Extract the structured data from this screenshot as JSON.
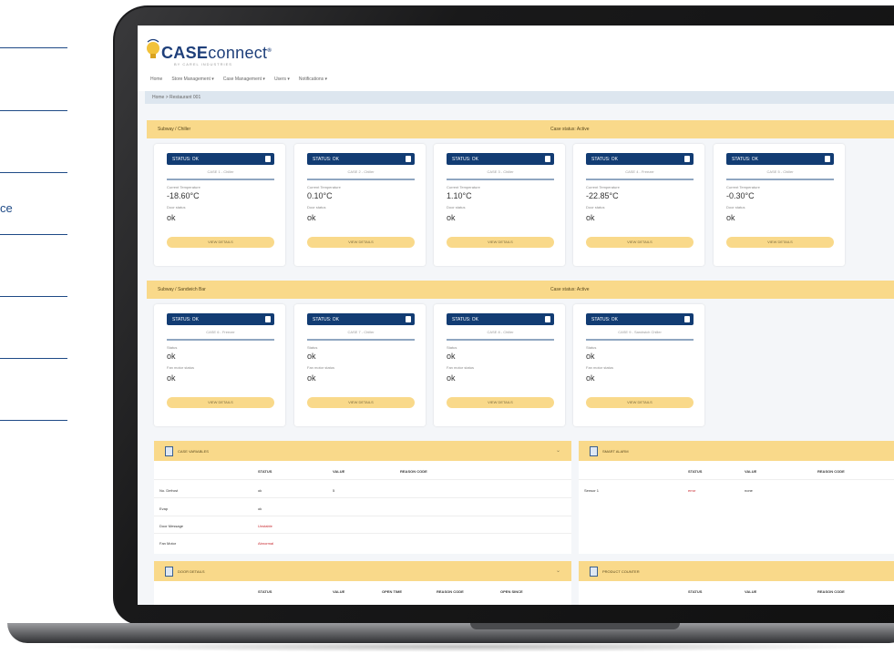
{
  "side_text": "ce",
  "app": {
    "logo_case": "CASE",
    "logo_connect": "connect",
    "logo_tm": "®",
    "tagline": "BY CAREL INDUSTRIES"
  },
  "nav": [
    "Home",
    "Store Management ▾",
    "Case Management ▾",
    "Users ▾",
    "Notifications ▾"
  ],
  "breadcrumb": "Home > Restaurant 001",
  "sections": [
    {
      "title": "Subway / Chiller",
      "middle": "Case status: Active",
      "cards": [
        {
          "status": "STATUS: OK",
          "sub": "CASE 1 - Chiller",
          "k1": "Current Temperature",
          "v1": "-18.60°C",
          "k2": "Door status",
          "v2": "ok",
          "btn": "VIEW DETAILS"
        },
        {
          "status": "STATUS: OK",
          "sub": "CASE 2 - Chiller",
          "k1": "Current Temperature",
          "v1": "0.10°C",
          "k2": "Door status",
          "v2": "ok",
          "btn": "VIEW DETAILS"
        },
        {
          "status": "STATUS: OK",
          "sub": "CASE 3 - Chiller",
          "k1": "Current Temperature",
          "v1": "1.10°C",
          "k2": "Door status",
          "v2": "ok",
          "btn": "VIEW DETAILS"
        },
        {
          "status": "STATUS: OK",
          "sub": "CASE 4 - Freezer",
          "k1": "Current Temperature",
          "v1": "-22.85°C",
          "k2": "Door status",
          "v2": "ok",
          "btn": "VIEW DETAILS"
        },
        {
          "status": "STATUS: OK",
          "sub": "CASE 5 - Chiller",
          "k1": "Current Temperature",
          "v1": "-0.30°C",
          "k2": "Door status",
          "v2": "ok",
          "btn": "VIEW DETAILS"
        }
      ]
    },
    {
      "title": "Subway / Sandwich Bar",
      "middle": "Case status: Active",
      "cards": [
        {
          "status": "STATUS: OK",
          "sub": "CASE 6 - Freezer",
          "k1": "Status",
          "v1": "ok",
          "k2": "Fan motor status",
          "v2": "ok",
          "btn": "VIEW DETAILS"
        },
        {
          "status": "STATUS: OK",
          "sub": "CASE 7 - Chiller",
          "k1": "Status",
          "v1": "ok",
          "k2": "Fan motor status",
          "v2": "ok",
          "btn": "VIEW DETAILS"
        },
        {
          "status": "STATUS: OK",
          "sub": "CASE 8 - Chiller",
          "k1": "Status",
          "v1": "ok",
          "k2": "Fan motor status",
          "v2": "ok",
          "btn": "VIEW DETAILS"
        },
        {
          "status": "STATUS: OK",
          "sub": "CASE 9 - Sandwich Chiller",
          "k1": "Status",
          "v1": "ok",
          "k2": "Fan motor status",
          "v2": "ok",
          "btn": "VIEW DETAILS"
        }
      ]
    }
  ],
  "panels": {
    "case_variables": {
      "title": "CASE VARIABLES",
      "headers": [
        "STATUS",
        "VALUE",
        "REASON CODE"
      ],
      "rows": [
        {
          "name": "No. Defrost",
          "status": "ok",
          "value": "5"
        },
        {
          "name": "Evap",
          "status": "ok",
          "value": ""
        },
        {
          "name": "Door Message",
          "status": "Unstable",
          "value": ""
        },
        {
          "name": "Fan Motor",
          "status": "Abnormal",
          "value": ""
        }
      ]
    },
    "smart_alarm": {
      "title": "SMART ALARM",
      "headers": [
        "STATUS",
        "VALUE",
        "REASON CODE"
      ],
      "rows": [
        {
          "name": "Sensor 1",
          "status": "error",
          "value": "none"
        }
      ]
    },
    "door_details": {
      "title": "DOOR DETAILS",
      "headers": [
        "STATUS",
        "VALUE",
        "OPEN TIME",
        "REASON CODE",
        "OPEN SINCE"
      ]
    },
    "product_counter": {
      "title": "PRODUCT COUNTER",
      "headers": [
        "STATUS",
        "VALUE",
        "REASON CODE"
      ]
    }
  },
  "colors": {
    "accent_yellow": "#f9d98a",
    "navy": "#123c73",
    "alert_red": "#c8282e"
  }
}
